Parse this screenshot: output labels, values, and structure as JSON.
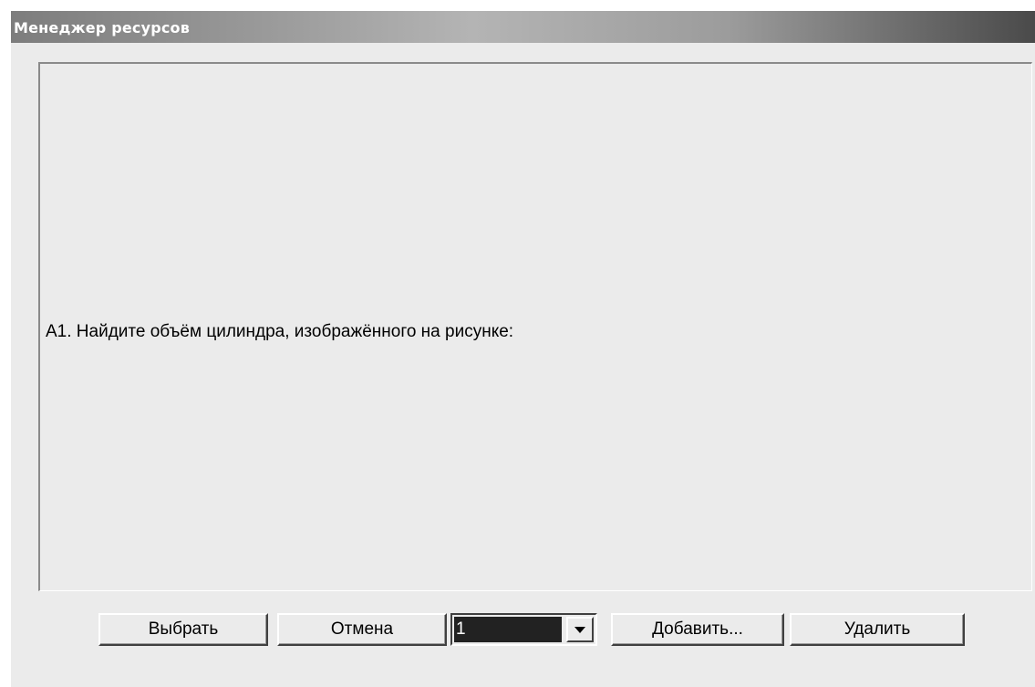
{
  "window": {
    "title": "Менеджер ресурсов"
  },
  "content": {
    "question_text": "А1. Найдите объём цилиндра, изображённого на рисунке:"
  },
  "buttons": {
    "select_label": "Выбрать",
    "cancel_label": "Отмена",
    "add_label": "Добавить...",
    "delete_label": "Удалить"
  },
  "combo": {
    "selected_value": "1",
    "arrow_icon": "chevron-down-icon"
  }
}
